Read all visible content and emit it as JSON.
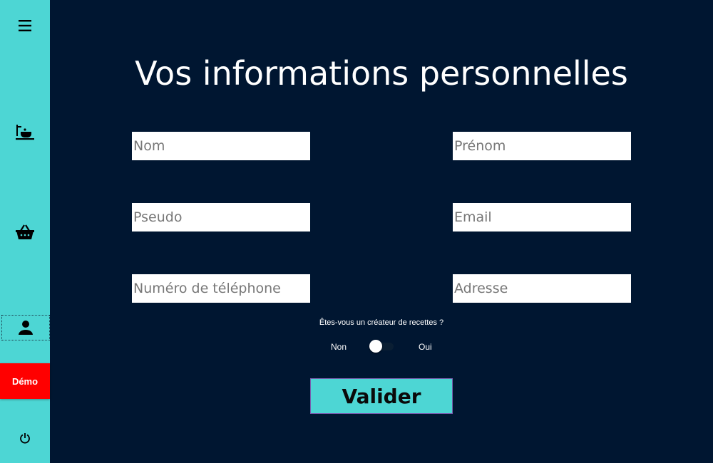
{
  "sidebar": {
    "icons": [
      "menu-icon",
      "cooking-icon",
      "basket-icon",
      "user-icon",
      "power-icon"
    ],
    "demo_label": "Démo"
  },
  "page": {
    "title": "Vos informations personnelles"
  },
  "form": {
    "nom_placeholder": "Nom",
    "prenom_placeholder": "Prénom",
    "pseudo_placeholder": "Pseudo",
    "email_placeholder": "Email",
    "telephone_placeholder": "Numéro de téléphone",
    "adresse_placeholder": "Adresse",
    "creator_question": "Êtes-vous un créateur de recettes ?",
    "toggle_off_label": "Non",
    "toggle_on_label": "Oui",
    "toggle_value": false,
    "submit_label": "Valider"
  },
  "colors": {
    "background": "#001631",
    "sidebar": "#4dd6d4",
    "demo": "#ff0000",
    "button": "#4dd6d4"
  }
}
